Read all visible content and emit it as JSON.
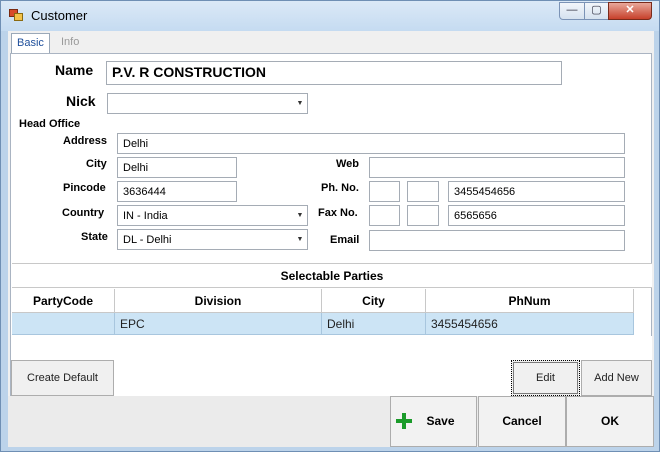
{
  "window": {
    "title": "Customer",
    "minimize": "—",
    "maximize": "▢",
    "close": "✕"
  },
  "tabs": [
    {
      "label": "Basic"
    },
    {
      "label": "Info"
    }
  ],
  "form": {
    "name_label": "Name",
    "name_value": "P.V. R CONSTRUCTION",
    "nick_label": "Nick",
    "nick_value": "",
    "head_office_label": "Head Office",
    "address_label": "Address",
    "address_value": "Delhi",
    "city_label": "City",
    "city_value": "Delhi",
    "web_label": "Web",
    "web_value": "",
    "pincode_label": "Pincode",
    "pincode_value": "3636444",
    "phone_label": "Ph. No.",
    "phone_code1": "",
    "phone_code2": "",
    "phone_value": "3455454656",
    "country_label": "Country",
    "country_value": "IN - India",
    "fax_label": "Fax No.",
    "fax_code1": "",
    "fax_code2": "",
    "fax_value": "6565656",
    "state_label": "State",
    "state_value": "DL - Delhi",
    "email_label": "Email",
    "email_value": ""
  },
  "parties": {
    "title": "Selectable Parties",
    "columns": [
      "PartyCode",
      "Division",
      "City",
      "PhNum"
    ],
    "rows": [
      {
        "party_code": "",
        "division": "EPC",
        "city": "Delhi",
        "phnum": "3455454656"
      }
    ]
  },
  "buttons": {
    "create_default": "Create Default",
    "edit": "Edit",
    "add_new": "Add New",
    "save": "Save",
    "cancel": "Cancel",
    "ok": "OK"
  },
  "colors": {
    "accent": "#1b9b2a",
    "selection": "#cce4f5",
    "tab_text": "#1f4f9b"
  }
}
